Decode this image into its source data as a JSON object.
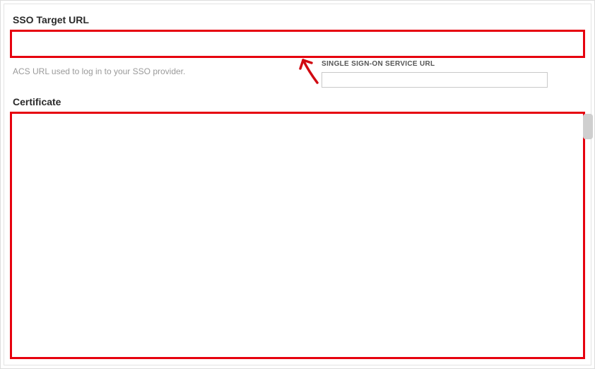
{
  "section": {
    "sso_target_label": "SSO Target URL",
    "sso_target_value": "",
    "helper_text": "ACS URL used to log in to your SSO provider.",
    "certificate_label": "Certificate",
    "certificate_value": ""
  },
  "overlay": {
    "sso_service_label": "SINGLE SIGN-ON SERVICE URL",
    "sso_service_value": ""
  },
  "colors": {
    "highlight": "#e6000e",
    "arrow": "#d10a12"
  }
}
